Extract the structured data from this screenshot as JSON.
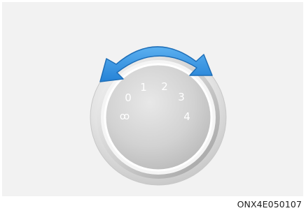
{
  "figure": {
    "dial": {
      "name": "fan-speed-knob",
      "positions": [
        "0",
        "1",
        "2",
        "3",
        "4"
      ],
      "off_icon": "fan-icon",
      "off_glyph": "ꝏ",
      "arrow_color": "#2f8fe0",
      "arrow_outline": "#1f6fb8"
    },
    "caption": "ONX4E050107"
  }
}
